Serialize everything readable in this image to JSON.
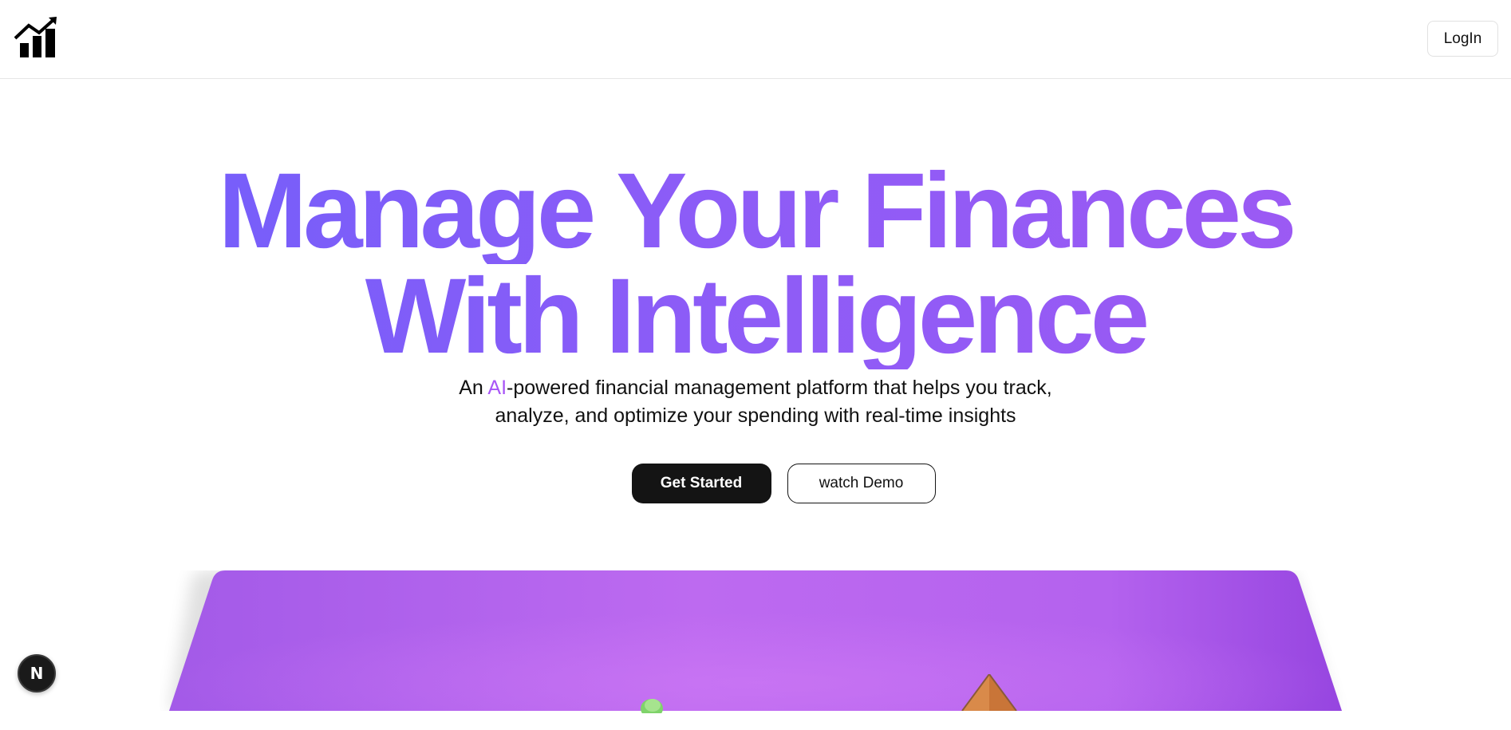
{
  "header": {
    "logo_icon": "bar-chart-trend-icon",
    "login_label": "LogIn"
  },
  "hero": {
    "headline_line1": "Manage Your Finances",
    "headline_line2": "With Intelligence",
    "subtitle_prefix": "An ",
    "subtitle_highlight": "AI",
    "subtitle_line1_rest": "-powered financial management platform that helps you track,",
    "subtitle_line2": "analyze, and optimize your spending with real-time insights",
    "get_started_label": "Get Started",
    "watch_demo_label": "watch Demo"
  },
  "badge": {
    "letter": "N",
    "icon": "nextjs-dev-indicator-icon"
  },
  "colors": {
    "headline_gradient_start": "#6d5ffb",
    "headline_gradient_end": "#a159f2",
    "ai_highlight": "#a855f7",
    "primary_button": "#141414",
    "panel_purple": "#b05ced"
  }
}
